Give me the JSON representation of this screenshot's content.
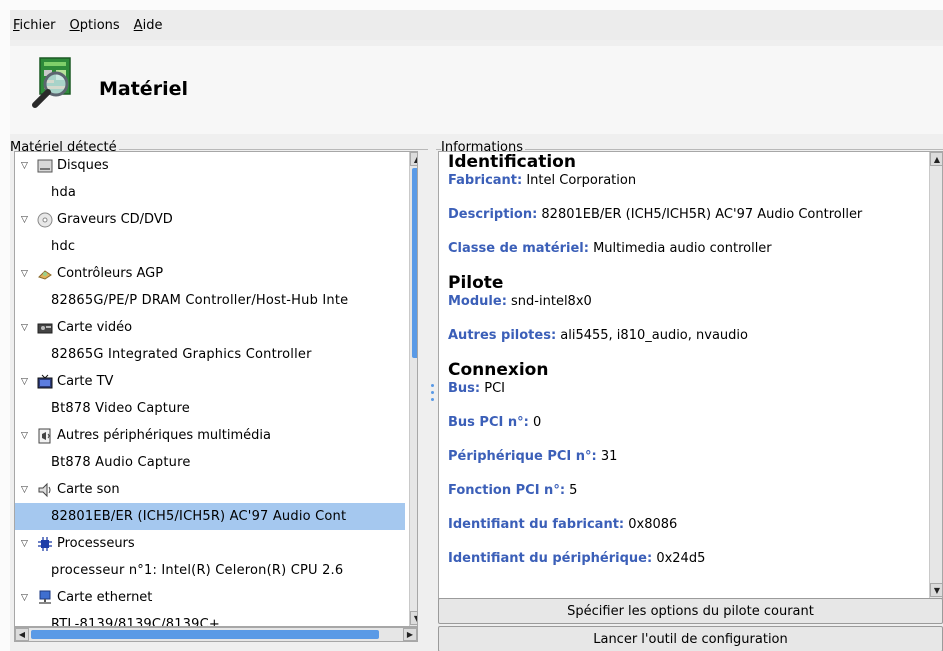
{
  "menubar": {
    "items": [
      {
        "accel": "F",
        "rest": "ichier"
      },
      {
        "accel": "O",
        "rest": "ptions"
      },
      {
        "accel": "A",
        "rest": "ide"
      }
    ]
  },
  "header": {
    "title": "Matériel",
    "icon": "hardware-magnifier-icon"
  },
  "left_panel": {
    "label": "Matériel détecté",
    "tree": [
      {
        "category": "Disques",
        "icon": "disk-icon",
        "items": [
          "hda"
        ]
      },
      {
        "category": "Graveurs CD/DVD",
        "icon": "cdrom-icon",
        "items": [
          "hdc"
        ]
      },
      {
        "category": "Contrôleurs AGP",
        "icon": "agp-icon",
        "items": [
          "82865G/PE/P DRAM Controller/Host-Hub Inte"
        ]
      },
      {
        "category": "Carte vidéo",
        "icon": "video-card-icon",
        "items": [
          "82865G Integrated Graphics Controller"
        ]
      },
      {
        "category": "Carte TV",
        "icon": "tv-card-icon",
        "items": [
          "Bt878 Video Capture"
        ]
      },
      {
        "category": "Autres périphériques multimédia",
        "icon": "multimedia-icon",
        "items": [
          "Bt878 Audio Capture"
        ]
      },
      {
        "category": "Carte son",
        "icon": "speaker-icon",
        "items": [
          "82801EB/ER (ICH5/ICH5R) AC'97 Audio Cont"
        ]
      },
      {
        "category": "Processeurs",
        "icon": "cpu-icon",
        "items": [
          "processeur n°1: Intel(R) Celeron(R) CPU 2.6"
        ]
      },
      {
        "category": "Carte ethernet",
        "icon": "network-icon",
        "items": [
          "RTL-8139/8139C/8139C+"
        ]
      }
    ],
    "selected": "82801EB/ER (ICH5/ICH5R) AC'97 Audio Cont"
  },
  "right_panel": {
    "label": "Informations",
    "identification": {
      "title": "Identification",
      "fabricant_k": "Fabricant:",
      "fabricant_v": " Intel Corporation",
      "description_k": "Description:",
      "description_v": " 82801EB/ER (ICH5/ICH5R) AC'97 Audio Controller",
      "classe_k": "Classe de matériel:",
      "classe_v": " Multimedia audio controller"
    },
    "pilote": {
      "title": "Pilote",
      "module_k": "Module:",
      "module_v": " snd-intel8x0",
      "autres_k": "Autres pilotes:",
      "autres_v": " ali5455, i810_audio, nvaudio"
    },
    "connexion": {
      "title": "Connexion",
      "bus_k": "Bus:",
      "bus_v": " PCI",
      "buspci_k": "Bus PCI n°:",
      "buspci_v": " 0",
      "periph_k": "Périphérique PCI n°:",
      "periph_v": " 31",
      "fonction_k": "Fonction PCI n°:",
      "fonction_v": " 5",
      "idfab_k": "Identifiant du fabricant:",
      "idfab_v": " 0x8086",
      "idper_k": "Identifiant du périphérique:",
      "idper_v": " 0x24d5"
    }
  },
  "buttons": {
    "driver_options": "Spécifier les options du pilote courant",
    "config_tool": "Lancer l'outil de configuration"
  }
}
